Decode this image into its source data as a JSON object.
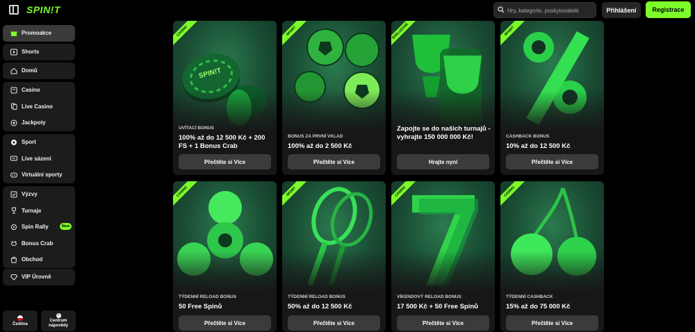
{
  "header": {
    "logo": "SPIN!T",
    "search_placeholder": "Hry, kategorie, poskytovatelé",
    "login_label": "Přihlášení",
    "register_label": "Registrace"
  },
  "colors": {
    "accent": "#7cfc2a",
    "background": "#000000",
    "panel": "#1c1c1c"
  },
  "sidebar": {
    "groups": [
      {
        "items": [
          {
            "label": "Promoakce",
            "icon": "gift-icon",
            "active": true
          }
        ]
      },
      {
        "items": [
          {
            "label": "Shorts",
            "icon": "play-icon"
          }
        ]
      },
      {
        "items": [
          {
            "label": "Domů",
            "icon": "home-icon"
          }
        ]
      },
      {
        "items": [
          {
            "label": "Casino",
            "icon": "slot-icon"
          },
          {
            "label": "Live Casino",
            "icon": "cards-icon"
          },
          {
            "label": "Jackpoty",
            "icon": "jackpot-icon"
          }
        ]
      },
      {
        "items": [
          {
            "label": "Sport",
            "icon": "ball-icon"
          },
          {
            "label": "Live sázení",
            "icon": "live-icon"
          },
          {
            "label": "Virtuální sporty",
            "icon": "virtual-icon"
          }
        ]
      },
      {
        "items": [
          {
            "label": "Výzvy",
            "icon": "challenge-icon"
          },
          {
            "label": "Turnaje",
            "icon": "trophy-icon"
          },
          {
            "label": "Spin Rally",
            "icon": "rally-icon",
            "badge": "New"
          },
          {
            "label": "Bonus Crab",
            "icon": "crab-icon"
          },
          {
            "label": "Obchod",
            "icon": "shop-icon"
          }
        ]
      },
      {
        "items": [
          {
            "label": "VIP Úrovně",
            "icon": "diamond-icon"
          }
        ]
      }
    ],
    "language_label": "Čeština",
    "help_label_1": "Centrum",
    "help_label_2": "nápovědy"
  },
  "cards": [
    {
      "ribbon": "CASINO",
      "subtitle": "UVÍTACÍ BONUS",
      "headline": "100% až do 12 500 Kč + 200 FS + 1 Bonus Crab",
      "cta": "Přečtěte si Více",
      "art": "chips"
    },
    {
      "ribbon": "SPORT",
      "subtitle": "BONUS ZA PRVNÍ VKLAD",
      "headline": "100% až do 2 500 Kč",
      "cta": "Přečtěte si Více",
      "art": "balls"
    },
    {
      "ribbon": "EXKLUZIVNÍ",
      "subtitle": "",
      "headline": "Zapojte se do našich turnajů - vyhrajte 150 000 000 Kč!",
      "cta": "Hrajte nyní",
      "art": "trophy"
    },
    {
      "ribbon": "SPORT",
      "subtitle": "CASHBACK BONUS",
      "headline": "10% až do 12 500 Kč",
      "cta": "Přečtěte si Více",
      "art": "percent"
    },
    {
      "ribbon": "CASINO",
      "subtitle": "TÝDENNÍ RELOAD BONUS",
      "headline": "50 Free Spinů",
      "cta": "Přečtěte si Více",
      "art": "spinner"
    },
    {
      "ribbon": "SPORT",
      "subtitle": "TÝDENNÍ RELOAD BONUS",
      "headline": "50% až do 12 500 Kč",
      "cta": "Přečtěte si Více",
      "art": "rackets"
    },
    {
      "ribbon": "CASINO",
      "subtitle": "VÍKENDOVÝ RELOAD BONUS",
      "headline": "17 500 Kč + 50 Free Spinů",
      "cta": "Přečtěte si Více",
      "art": "seven"
    },
    {
      "ribbon": "CASINO",
      "subtitle": "TÝDENNÍ CASHBACK",
      "headline": "15% až do 75 000 Kč",
      "cta": "Přečtěte si Více",
      "art": "cherry"
    }
  ]
}
